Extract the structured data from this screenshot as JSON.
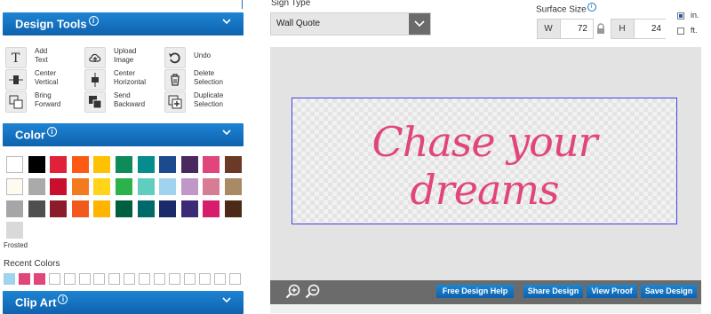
{
  "design_tools": {
    "title": "Design Tools",
    "info": "i",
    "tools": [
      {
        "label": "Add\nText",
        "icon": "text-icon"
      },
      {
        "label": "Upload\nImage",
        "icon": "upload-cloud-icon"
      },
      {
        "label": "Undo",
        "icon": "undo-icon"
      },
      {
        "label": "Center\nVertical",
        "icon": "center-vertical-icon"
      },
      {
        "label": "Center\nHorizontal",
        "icon": "center-horizontal-icon"
      },
      {
        "label": "Delete\nSelection",
        "icon": "trash-icon"
      },
      {
        "label": "Bring\nForward",
        "icon": "bring-forward-icon"
      },
      {
        "label": "Send\nBackward",
        "icon": "send-backward-icon"
      },
      {
        "label": "Duplicate\nSelection",
        "icon": "duplicate-icon"
      }
    ]
  },
  "color_panel": {
    "title": "Color",
    "info": "i",
    "swatches": [
      [
        "#ffffff",
        "#000000",
        "#e1203a",
        "#ff5a14",
        "#ffc100",
        "#0f8a5b",
        "#058c8c",
        "#1b4a8f",
        "#4a2a5e",
        "#e0457b",
        "#6b3a26"
      ],
      [
        "#fdfaf0",
        "#aaaaaa",
        "#c8102e",
        "#f47a20",
        "#ffd41a",
        "#2cb24a",
        "#5fcdc0",
        "#9fd3ee",
        "#bf98c8",
        "#d67c94",
        "#a88a65"
      ],
      [
        "#a6a6a6",
        "#4f4f4f",
        "#8a1c2b",
        "#f25a1d",
        "#ffb400",
        "#005f3f",
        "#006a6a",
        "#1a2a6a",
        "#3d2a76",
        "#d61e6a",
        "#4c2a18"
      ]
    ],
    "frosted_label": "Frosted",
    "frosted_color": "#d9d9d9",
    "recent_label": "Recent Colors",
    "recent": [
      "#9fd3ee",
      "#e0457b",
      "#e0457b",
      "",
      "",
      "",
      "",
      "",
      "",
      "",
      "",
      "",
      "",
      "",
      "",
      ""
    ]
  },
  "clip_art": {
    "title": "Clip Art",
    "info": "i"
  },
  "sign_type": {
    "label": "Sign Type",
    "value": "Wall Quote"
  },
  "surface_size": {
    "label": "Surface Size",
    "info": "i",
    "w_label": "W",
    "w_value": "72",
    "h_label": "H",
    "h_value": "24",
    "unit_in": "in.",
    "unit_ft": "ft.",
    "selected_unit": "in."
  },
  "canvas": {
    "quote": "Chase your dreams",
    "quote_color": "#e0457b",
    "border_color": "#4444dd"
  },
  "bottom_bar": {
    "buttons": [
      "Free Design Help",
      "Share Design",
      "View Proof",
      "Save Design"
    ]
  },
  "colors": {
    "accent": "#1277c8",
    "bar": "#6b6b6b"
  }
}
